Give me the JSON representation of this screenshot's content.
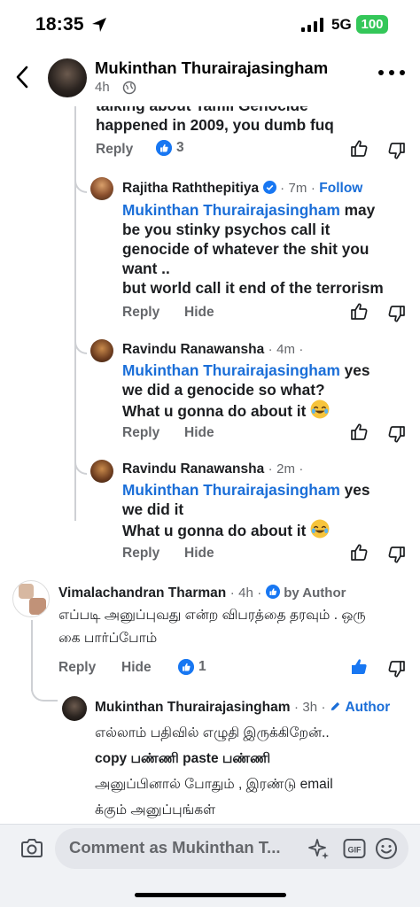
{
  "status_bar": {
    "time": "18:35",
    "network": "5G",
    "battery": "100",
    "icons": [
      "location-arrow-icon",
      "signal-icon"
    ]
  },
  "header": {
    "name": "Mukinthan Thurairajasingham",
    "time": "4h",
    "icons": [
      "back-icon",
      "globe-icon",
      "more-icon"
    ]
  },
  "comments": [
    {
      "id": "c0",
      "text_cut": "talking about Tamil Genocide",
      "text": "happened in 2009, you dumb fuq",
      "reply": "Reply",
      "reaction_count": "3"
    },
    {
      "id": "c1",
      "author": "Rajitha Raththepitiya",
      "time": "7m",
      "follow": "Follow",
      "mention": "Mukinthan Thurairajasingham",
      "text_lines": [
        "may",
        "be you stinky psychos call it",
        "genocide of whatever the shit you",
        "want ..",
        "but world call it end of the terrorism"
      ],
      "reply": "Reply",
      "hide": "Hide"
    },
    {
      "id": "c2",
      "author": "Ravindu Ranawansha",
      "time": "4m",
      "mention": "Mukinthan Thurairajasingham",
      "text_lines": [
        "yes",
        "we did a genocide so what?",
        "What u gonna do about it"
      ],
      "emoji": "rolling-on-floor-laughing",
      "reply": "Reply",
      "hide": "Hide"
    },
    {
      "id": "c3",
      "author": "Ravindu Ranawansha",
      "time": "2m",
      "mention": "Mukinthan Thurairajasingham",
      "text_lines": [
        "yes",
        "we did it",
        "What u gonna do about it"
      ],
      "emoji": "rolling-on-floor-laughing",
      "reply": "Reply",
      "hide": "Hide"
    },
    {
      "id": "c4",
      "author": "Vimalachandran Tharman",
      "time": "4h",
      "badge": "by Author",
      "text_lines": [
        "எப்படி அனுப்புவது என்ற விபரத்தை  தரவும் . ஒரு",
        "கை பார்ப்போம்"
      ],
      "reply": "Reply",
      "hide": "Hide",
      "reaction_count": "1"
    },
    {
      "id": "c5",
      "author": "Mukinthan Thurairajasingham",
      "time": "3h",
      "badge": "Author",
      "text_lines": [
        "எல்லாம் பதிவில் எழுதி இருக்கிறேன்..",
        "copy பண்ணி paste பண்ணி",
        "அனுப்பினால் போதும் , இரண்டு email",
        "க்கும் அனுப்புங்கள்"
      ]
    }
  ],
  "composer": {
    "placeholder": "Comment as Mukinthan T...",
    "icons": [
      "camera-icon",
      "sparkle-sticker-icon",
      "gif-icon",
      "emoji-icon"
    ]
  },
  "colors": {
    "accent": "#1a6ed8",
    "battery": "#34c759",
    "like": "#1877f2"
  }
}
